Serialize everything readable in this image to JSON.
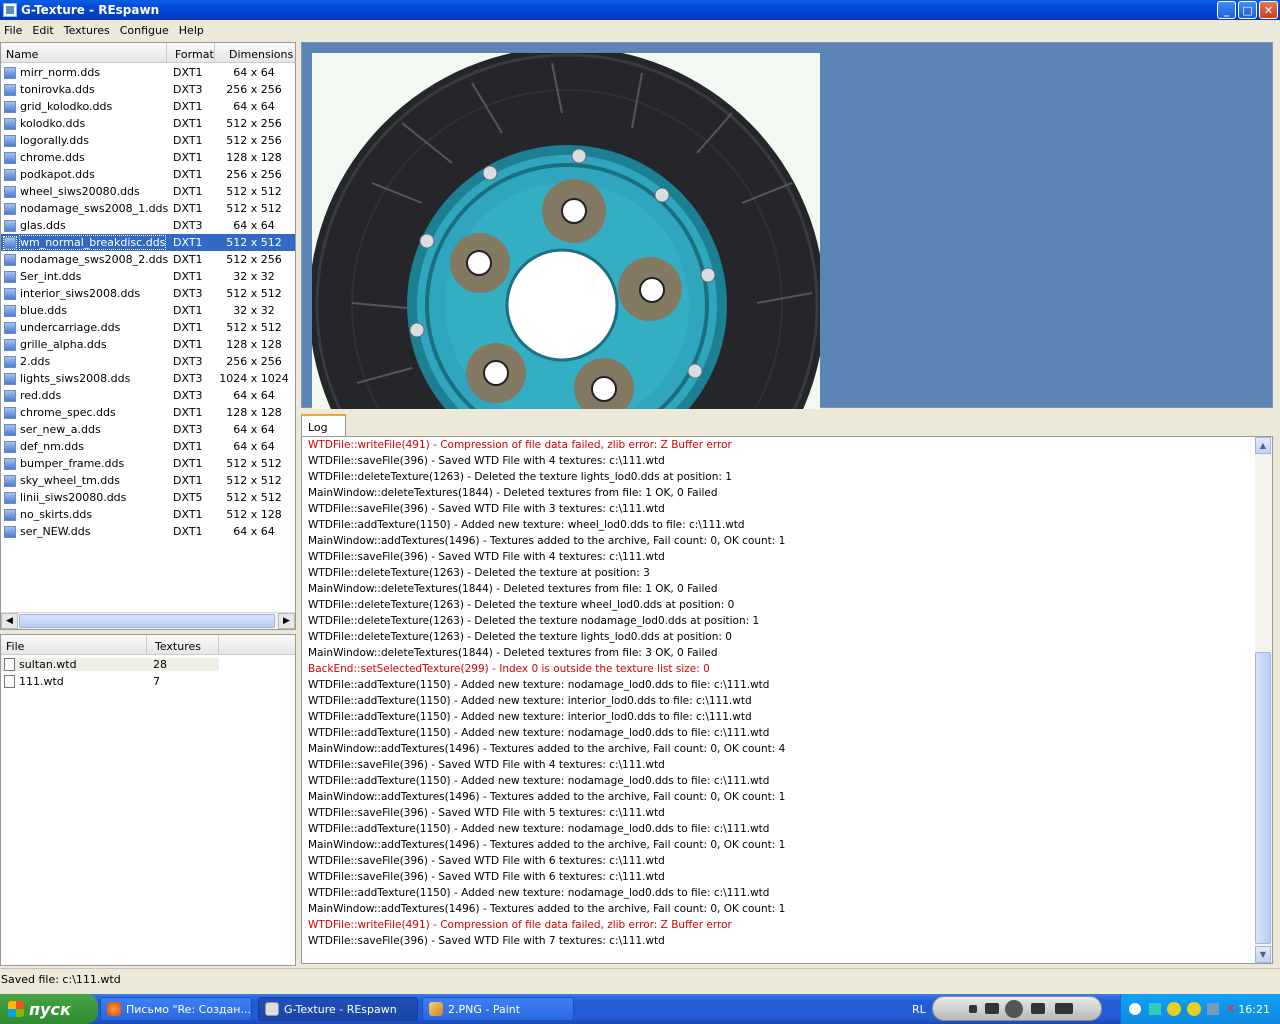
{
  "window": {
    "title": "G-Texture - REspawn",
    "min_icon": "minimize-icon",
    "max_icon": "maximize-icon",
    "close_icon": "close-icon"
  },
  "menu": [
    "File",
    "Edit",
    "Textures",
    "Configue",
    "Help"
  ],
  "texture_list": {
    "headers": {
      "name": "Name",
      "format": "Format",
      "dimensions": "Dimensions"
    },
    "rows": [
      {
        "name": "mirr_norm.dds",
        "format": "DXT1",
        "dim": "64 x 64"
      },
      {
        "name": "tonirovka.dds",
        "format": "DXT3",
        "dim": "256 x 256"
      },
      {
        "name": "grid_kolodko.dds",
        "format": "DXT1",
        "dim": "64 x 64"
      },
      {
        "name": "kolodko.dds",
        "format": "DXT1",
        "dim": "512 x 256"
      },
      {
        "name": "logorally.dds",
        "format": "DXT1",
        "dim": "512 x 256"
      },
      {
        "name": "chrome.dds",
        "format": "DXT1",
        "dim": "128 x 128"
      },
      {
        "name": "podkapot.dds",
        "format": "DXT1",
        "dim": "256 x 256"
      },
      {
        "name": "wheel_siws20080.dds",
        "format": "DXT1",
        "dim": "512 x 512"
      },
      {
        "name": "nodamage_sws2008_1.dds",
        "format": "DXT1",
        "dim": "512 x 512"
      },
      {
        "name": "glas.dds",
        "format": "DXT3",
        "dim": "64 x 64"
      },
      {
        "name": "wm_normal_breakdisc.dds",
        "format": "DXT1",
        "dim": "512 x 512"
      },
      {
        "name": "nodamage_sws2008_2.dds",
        "format": "DXT1",
        "dim": "512 x 256"
      },
      {
        "name": "Ser_int.dds",
        "format": "DXT1",
        "dim": "32 x 32"
      },
      {
        "name": "interior_siws2008.dds",
        "format": "DXT3",
        "dim": "512 x 512"
      },
      {
        "name": "blue.dds",
        "format": "DXT1",
        "dim": "32 x 32"
      },
      {
        "name": "undercarriage.dds",
        "format": "DXT1",
        "dim": "512 x 512"
      },
      {
        "name": "grille_alpha.dds",
        "format": "DXT1",
        "dim": "128 x 128"
      },
      {
        "name": "2.dds",
        "format": "DXT3",
        "dim": "256 x 256"
      },
      {
        "name": "lights_siws2008.dds",
        "format": "DXT3",
        "dim": "1024 x 1024"
      },
      {
        "name": "red.dds",
        "format": "DXT3",
        "dim": "64 x 64"
      },
      {
        "name": "chrome_spec.dds",
        "format": "DXT1",
        "dim": "128 x 128"
      },
      {
        "name": "ser_new_a.dds",
        "format": "DXT3",
        "dim": "64 x 64"
      },
      {
        "name": "def_nm.dds",
        "format": "DXT1",
        "dim": "64 x 64"
      },
      {
        "name": "bumper_frame.dds",
        "format": "DXT1",
        "dim": "512 x 512"
      },
      {
        "name": "sky_wheel_tm.dds",
        "format": "DXT1",
        "dim": "512 x 512"
      },
      {
        "name": "linii_siws20080.dds",
        "format": "DXT5",
        "dim": "512 x 512"
      },
      {
        "name": "no_skirts.dds",
        "format": "DXT1",
        "dim": "512 x 128"
      },
      {
        "name": "ser_NEW.dds",
        "format": "DXT1",
        "dim": "64 x 64"
      }
    ],
    "selected_index": 10
  },
  "file_list": {
    "headers": {
      "file": "File",
      "textures": "Textures"
    },
    "rows": [
      {
        "file": "sultan.wtd",
        "textures": "28"
      },
      {
        "file": "111.wtd",
        "textures": "7"
      }
    ]
  },
  "log_tab": "Log",
  "log": [
    {
      "text": "WTDFile::writeFile(491) - Compression of file data failed, zlib error: Z Buffer error",
      "error": true
    },
    {
      "text": "WTDFile::saveFile(396) - Saved WTD File with 4 textures: c:\\111.wtd",
      "error": false
    },
    {
      "text": "WTDFile::deleteTexture(1263) - Deleted the texture lights_lod0.dds at position: 1",
      "error": false
    },
    {
      "text": "MainWindow::deleteTextures(1844) - Deleted textures from file: 1 OK, 0 Failed",
      "error": false
    },
    {
      "text": "WTDFile::saveFile(396) - Saved WTD File with 3 textures: c:\\111.wtd",
      "error": false
    },
    {
      "text": "WTDFile::addTexture(1150) - Added new texture: wheel_lod0.dds to file: c:\\111.wtd",
      "error": false
    },
    {
      "text": "MainWindow::addTextures(1496) - Textures added to the archive, Fail count: 0, OK count: 1",
      "error": false
    },
    {
      "text": "WTDFile::saveFile(396) - Saved WTD File with 4 textures: c:\\111.wtd",
      "error": false
    },
    {
      "text": "WTDFile::deleteTexture(1263) - Deleted the texture  at position: 3",
      "error": false
    },
    {
      "text": "MainWindow::deleteTextures(1844) - Deleted textures from file: 1 OK, 0 Failed",
      "error": false
    },
    {
      "text": "WTDFile::deleteTexture(1263) - Deleted the texture wheel_lod0.dds at position: 0",
      "error": false
    },
    {
      "text": "WTDFile::deleteTexture(1263) - Deleted the texture nodamage_lod0.dds at position: 1",
      "error": false
    },
    {
      "text": "WTDFile::deleteTexture(1263) - Deleted the texture lights_lod0.dds at position: 0",
      "error": false
    },
    {
      "text": "MainWindow::deleteTextures(1844) - Deleted textures from file: 3 OK, 0 Failed",
      "error": false
    },
    {
      "text": "BackEnd::setSelectedTexture(299) - Index 0 is outside the texture list size: 0",
      "error": true
    },
    {
      "text": "WTDFile::addTexture(1150) - Added new texture: nodamage_lod0.dds to file: c:\\111.wtd",
      "error": false
    },
    {
      "text": "WTDFile::addTexture(1150) - Added new texture: interior_lod0.dds to file: c:\\111.wtd",
      "error": false
    },
    {
      "text": "WTDFile::addTexture(1150) - Added new texture: interior_lod0.dds to file: c:\\111.wtd",
      "error": false
    },
    {
      "text": "WTDFile::addTexture(1150) - Added new texture: nodamage_lod0.dds to file: c:\\111.wtd",
      "error": false
    },
    {
      "text": "MainWindow::addTextures(1496) - Textures added to the archive, Fail count: 0, OK count: 4",
      "error": false
    },
    {
      "text": "WTDFile::saveFile(396) - Saved WTD File with 4 textures: c:\\111.wtd",
      "error": false
    },
    {
      "text": "WTDFile::addTexture(1150) - Added new texture: nodamage_lod0.dds to file: c:\\111.wtd",
      "error": false
    },
    {
      "text": "MainWindow::addTextures(1496) - Textures added to the archive, Fail count: 0, OK count: 1",
      "error": false
    },
    {
      "text": "WTDFile::saveFile(396) - Saved WTD File with 5 textures: c:\\111.wtd",
      "error": false
    },
    {
      "text": "WTDFile::addTexture(1150) - Added new texture: nodamage_lod0.dds to file: c:\\111.wtd",
      "error": false
    },
    {
      "text": "MainWindow::addTextures(1496) - Textures added to the archive, Fail count: 0, OK count: 1",
      "error": false
    },
    {
      "text": "WTDFile::saveFile(396) - Saved WTD File with 6 textures: c:\\111.wtd",
      "error": false
    },
    {
      "text": "WTDFile::saveFile(396) - Saved WTD File with 6 textures: c:\\111.wtd",
      "error": false
    },
    {
      "text": "WTDFile::addTexture(1150) - Added new texture: nodamage_lod0.dds to file: c:\\111.wtd",
      "error": false
    },
    {
      "text": "MainWindow::addTextures(1496) - Textures added to the archive, Fail count: 0, OK count: 1",
      "error": false
    },
    {
      "text": "WTDFile::writeFile(491) - Compression of file data failed, zlib error: Z Buffer error",
      "error": true
    },
    {
      "text": "WTDFile::saveFile(396) - Saved WTD File with 7 textures: c:\\111.wtd",
      "error": false
    }
  ],
  "status": "Saved file: c:\\111.wtd",
  "taskbar": {
    "start": "пуск",
    "tasks": [
      {
        "label": "Письмо \"Re: Создан...",
        "icon": "firefox-icon"
      },
      {
        "label": "G-Texture - REspawn",
        "icon": "gtexture-icon"
      },
      {
        "label": "2.PNG - Paint",
        "icon": "paint-icon"
      }
    ],
    "lang": "RL",
    "clock": "16:21"
  },
  "colors": {
    "accent": "#316ac5",
    "error": "#dd0000",
    "preview_bg": "#5c85b5",
    "disc_teal": "#2fa6bd"
  }
}
